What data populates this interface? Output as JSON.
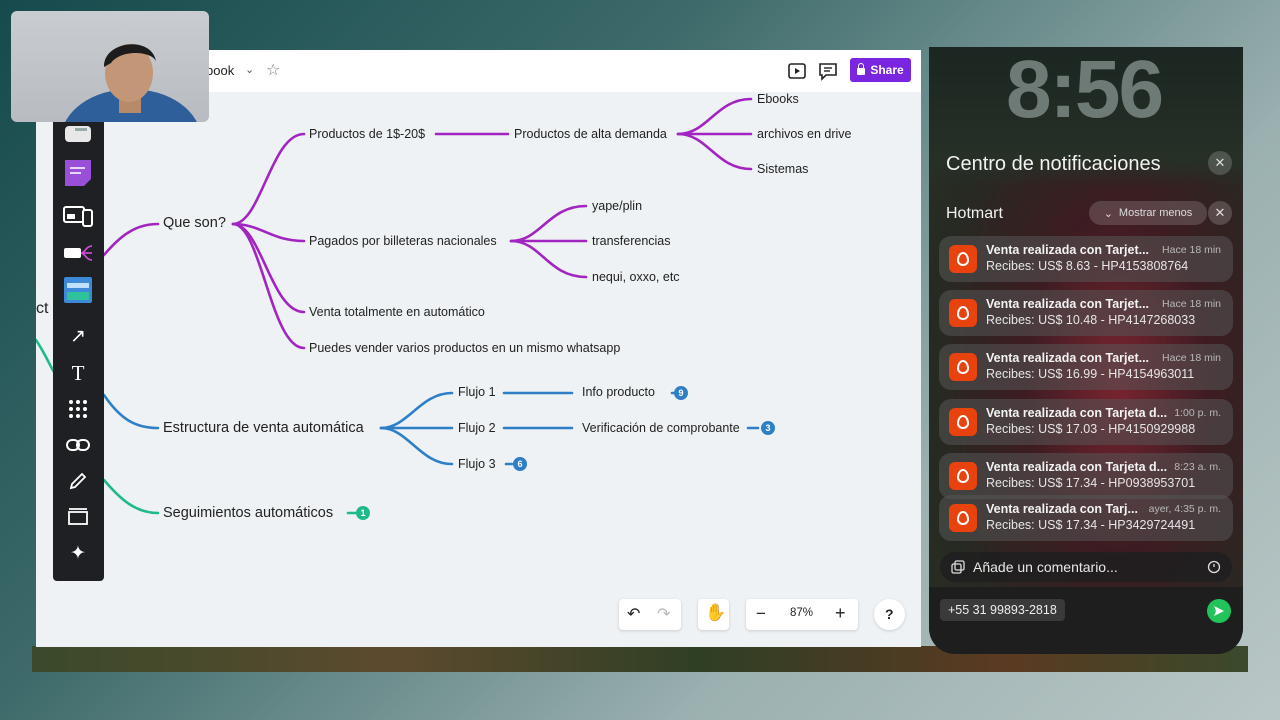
{
  "board": {
    "doc_title": "book",
    "share_label": "Share",
    "nodes": {
      "que_son": "Que son?",
      "productos_1_20": "Productos de 1$-20$",
      "alta_demanda": "Productos de alta demanda",
      "ebooks": "Ebooks",
      "archivos": "archivos en drive",
      "sistemas": "Sistemas",
      "pagados": "Pagados por billeteras nacionales",
      "yape": "yape/plin",
      "transferencias": "transferencias",
      "nequi": "nequi, oxxo, etc",
      "venta_auto": "Venta totalmente en automático",
      "varios_productos": "Puedes vender varios productos en un mismo whatsapp",
      "estructura": "Estructura de venta automática",
      "flujo1": "Flujo 1",
      "flujo2": "Flujo 2",
      "flujo3": "Flujo 3",
      "info_producto": "Info producto",
      "verificacion": "Verificación de comprobante",
      "seguimientos": "Seguimientos automáticos",
      "cut_text": "ct"
    },
    "badges": {
      "info": "9",
      "verif": "3",
      "flujo3": "6",
      "seguimientos": "1"
    },
    "zoom": "87%",
    "help": "?",
    "colors": {
      "purple": "#a225c2",
      "blue": "#2f7fc6",
      "green": "#1fba8c",
      "share": "#7a25e0"
    }
  },
  "phone": {
    "clock": "8:56",
    "nc_title": "Centro de notificaciones",
    "app_name": "Hotmart",
    "show_less": "Mostrar menos",
    "notifications": [
      {
        "title": "Venta realizada con Tarjet...",
        "time": "Hace 18 min",
        "body": "Recibes: US$ 8.63 - HP4153808764"
      },
      {
        "title": "Venta realizada con Tarjet...",
        "time": "Hace 18 min",
        "body": "Recibes: US$ 10.48 - HP4147268033"
      },
      {
        "title": "Venta realizada con Tarjet...",
        "time": "Hace 18 min",
        "body": "Recibes: US$ 16.99 - HP4154963011"
      },
      {
        "title": "Venta realizada con Tarjeta d...",
        "time": "1:00 p. m.",
        "body": "Recibes: US$ 17.03 - HP4150929988"
      },
      {
        "title": "Venta realizada con Tarjeta d...",
        "time": "8:23 a. m.",
        "body": "Recibes: US$ 17.34 - HP0938953701"
      },
      {
        "title": "Venta realizada con Tarj...",
        "time": "ayer, 4:35 p. m.",
        "body": "Recibes: US$ 17.34 - HP3429724491"
      }
    ],
    "comment_placeholder": "Añade un comentario...",
    "phone_number": "+55 31 99893-2818"
  }
}
